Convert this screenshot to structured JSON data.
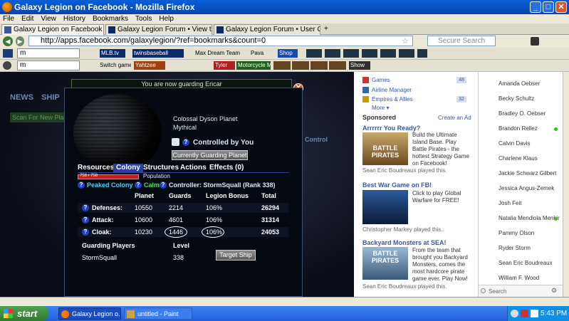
{
  "window": {
    "title": "Galaxy Legion on Facebook - Mozilla Firefox"
  },
  "menu": [
    "File",
    "Edit",
    "View",
    "History",
    "Bookmarks",
    "Tools",
    "Help"
  ],
  "tabs": [
    {
      "label": "Galaxy Legion on Facebook",
      "active": true
    },
    {
      "label": "Galaxy Legion Forum • View top..."
    },
    {
      "label": "Galaxy Legion Forum • User Co..."
    }
  ],
  "nav": {
    "url": "http://apps.facebook.com/galaxylegion/?ref=bookmarks&count=0",
    "search_placeholder": "Secure Search"
  },
  "toolbar1": {
    "input_value": "m",
    "items": [
      "MLB.tv",
      "twinsbaseball",
      "Max Dream Team",
      "Pava",
      "Shop"
    ]
  },
  "toolbar2": {
    "input_value": "m",
    "items": [
      "Switch game:",
      "Yahtzee",
      "Tyler",
      "Motorcycle Madness",
      "Show"
    ]
  },
  "game": {
    "nav": [
      "NEWS",
      "SHIP"
    ],
    "guard_notice": "You are now guarding Ericar",
    "planet_name": "Colossal Dyson Planet",
    "planet_type": "Mythical",
    "controlled": "Controlled by You",
    "guard_button": "Currently Guarding Planet",
    "tabs": [
      "Resources",
      "Colony",
      "Structures",
      "Actions",
      "Effects (0)"
    ],
    "population_value": "758 / 758",
    "population_fill": 1.0,
    "population_label": "Population",
    "status_peaked": "Peaked Colony",
    "status_calm": "Calm",
    "controller": "Controller: StormSquall (Rank 338)",
    "headers": [
      "Planet",
      "Guards",
      "Legion Bonus",
      "Total"
    ],
    "rows": [
      {
        "label": "Defenses:",
        "planet": "10550",
        "guards": "2214",
        "bonus": "106%",
        "total": "26294"
      },
      {
        "label": "Attack:",
        "planet": "10600",
        "guards": "4601",
        "bonus": "106%",
        "total": "31314"
      },
      {
        "label": "Cloak:",
        "planet": "10230",
        "guards": "1446",
        "bonus": "106%",
        "total": "24053"
      }
    ],
    "guarding_header": "Guarding Players",
    "level_header": "Level",
    "guard_player": "StormSquall",
    "guard_level": "338",
    "target_button": "Target Ship",
    "bg_labels": [
      "Scan For New Pla",
      "Control"
    ]
  },
  "sidebar": {
    "apps": [
      {
        "label": "Games",
        "badge": "48",
        "color": "#c33"
      },
      {
        "label": "Airline Manager",
        "badge": "",
        "color": "#36a"
      },
      {
        "label": "Empires & Allies",
        "badge": "32",
        "color": "#c90"
      }
    ],
    "more": "More ▾",
    "sponsored": "Sponsored",
    "create_ad": "Create an Ad",
    "ads": [
      {
        "title": "Arrrrrr You Ready?",
        "img_label": "BATTLE PIRATES",
        "text": "Build the Ultimate Island Base. Play Battle Pirates - the hottest Strategy Game on Facebook!",
        "played": "Sean Eric Boudreaux played this."
      },
      {
        "title": "Best War Game on FB!",
        "img_label": "",
        "text": "Click to play Global Warfare for FREE!",
        "played": "Christopher Markey played this."
      },
      {
        "title": "Backyard Monsters at SEA!",
        "img_label": "BATTLE PIRATES",
        "text": "From the team that brought you Backyard Monsters, comes the most hardcore pirate game ever. Play Now!",
        "played": "Sean Eric Boudreaux played this."
      }
    ]
  },
  "chat": {
    "friends": [
      {
        "name": "Amanda Oebser",
        "online": false
      },
      {
        "name": "Becky Schultz",
        "online": false
      },
      {
        "name": "Bradley O. Oebser",
        "online": false
      },
      {
        "name": "Brandon Rellez",
        "online": true
      },
      {
        "name": "Calvin Davis",
        "online": false
      },
      {
        "name": "Charlene Klaus",
        "online": false
      },
      {
        "name": "Jackie Schwarz Gilbert",
        "online": false
      },
      {
        "name": "Jessica Angus-Zemek",
        "online": false
      },
      {
        "name": "Josh Feit",
        "online": false
      },
      {
        "name": "Natalia Mendiola Menkir",
        "online": true
      },
      {
        "name": "Pammy Olson",
        "online": false
      },
      {
        "name": "Ryder Storm",
        "online": false
      },
      {
        "name": "Sean Eric Boudreaux",
        "online": false
      },
      {
        "name": "William F. Wood",
        "online": false
      }
    ],
    "search_placeholder": "Search"
  },
  "taskbar": {
    "start": "start",
    "tasks": [
      "Galaxy Legion o...",
      "untitled - Paint"
    ],
    "time": "5:43 PM"
  }
}
